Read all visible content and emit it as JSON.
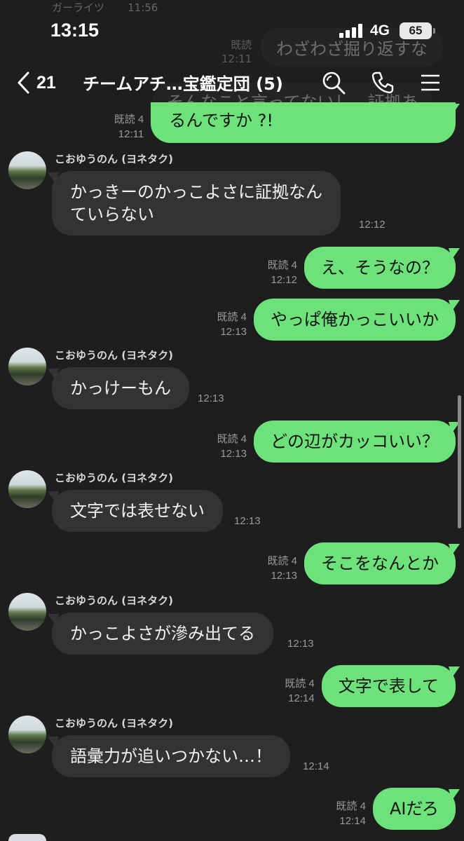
{
  "status_bar": {
    "time": "13:15",
    "network": "4G",
    "battery": "65"
  },
  "header": {
    "back_count": "21",
    "title": "チームアチ…宝鑑定団 (5)"
  },
  "faded": {
    "top_name": "ガーライツ",
    "top_time": "11:56",
    "msg1_read": "既読",
    "msg1_time": "12:11",
    "msg1_text": "わざわざ掘り返すな",
    "msg2_partial": "そんなこと言ってないし、証拠あ"
  },
  "messages": [
    {
      "dir": "out",
      "read": "既読 4",
      "time": "12:11",
      "text": "るんですか ?!"
    },
    {
      "dir": "in",
      "name": "こおゆうのん (ヨネタク)",
      "lines": [
        "かっきーのかっこよさに証拠なん",
        "ていらない"
      ],
      "time": "12:12"
    },
    {
      "dir": "out",
      "read": "既読 4",
      "time": "12:12",
      "text": "え、そうなの？"
    },
    {
      "dir": "out",
      "read": "既読 4",
      "time": "12:13",
      "text": "やっぱ俺かっこいいか"
    },
    {
      "dir": "in",
      "name": "こおゆうのん (ヨネタク)",
      "lines": [
        "かっけーもん"
      ],
      "time": "12:13"
    },
    {
      "dir": "out",
      "read": "既読 4",
      "time": "12:13",
      "text": "どの辺がカッコいい？"
    },
    {
      "dir": "in",
      "name": "こおゆうのん (ヨネタク)",
      "lines": [
        "文字では表せない"
      ],
      "time": "12:13"
    },
    {
      "dir": "out",
      "read": "既読 4",
      "time": "12:13",
      "text": "そこをなんとか"
    },
    {
      "dir": "in",
      "name": "こおゆうのん (ヨネタク)",
      "lines": [
        "かっこよさが滲み出てる"
      ],
      "time": "12:13"
    },
    {
      "dir": "out",
      "read": "既読 4",
      "time": "12:14",
      "text": "文字で表して"
    },
    {
      "dir": "in",
      "name": "こおゆうのん (ヨネタク)",
      "lines": [
        "語彙力が追いつかない…！"
      ],
      "time": "12:14"
    },
    {
      "dir": "out",
      "read": "既読 4",
      "time": "12:14",
      "text": "AIだろ"
    }
  ],
  "colors": {
    "background": "#1e1e1e",
    "outgoing_bubble": "#6de27a",
    "incoming_bubble": "#333333",
    "meta_text": "#9a9a9a"
  },
  "icons": {
    "back": "chevron-left-icon",
    "search": "search-icon",
    "call": "phone-icon",
    "menu": "hamburger-menu-icon"
  }
}
